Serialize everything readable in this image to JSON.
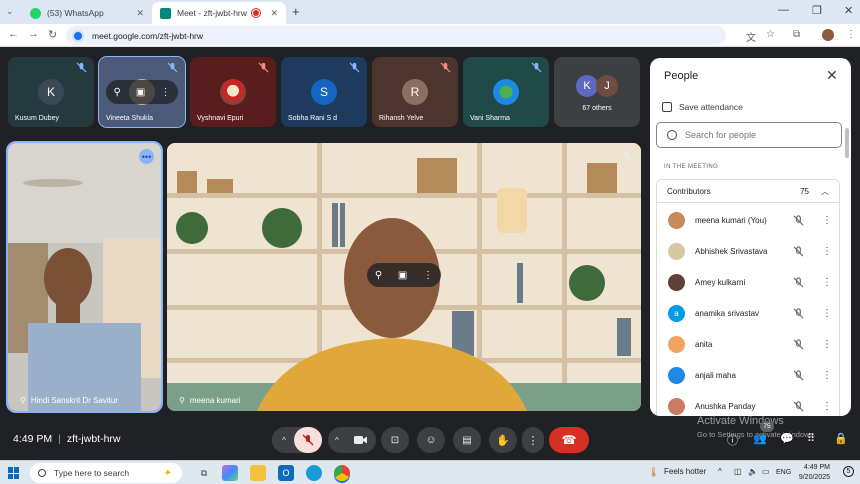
{
  "browser": {
    "tabs": [
      {
        "title": "(53) WhatsApp",
        "active": false,
        "favicon_color": "#25d366"
      },
      {
        "title": "Meet - zft-jwbt-hrw",
        "active": true,
        "favicon_color": "#00897b"
      }
    ],
    "url": "meet.google.com/zft-jwbt-hrw"
  },
  "participants_top": [
    {
      "name": "Kusum Dubey",
      "initial": "K",
      "avatar_color": "#3c4a55",
      "bg": "#253a3e"
    },
    {
      "name": "Vineeta Shukla",
      "bg": "#4a5a78"
    },
    {
      "name": "Vyshnavi Epuri",
      "bg": "#5a1d1d"
    },
    {
      "name": "Sobha Rani S d",
      "initial": "S",
      "avatar_color": "#1565c0",
      "bg": "#1e3b5e"
    },
    {
      "name": "Rihansh Yelve",
      "initial": "R",
      "avatar_color": "#8d6e63",
      "bg": "#4e342e"
    },
    {
      "name": "Vani Sharma",
      "bg": "#1f4a47"
    }
  ],
  "others": {
    "initials": [
      "K",
      "J"
    ],
    "colors": [
      "#5c6bc0",
      "#6d4c41"
    ],
    "label": "67 others"
  },
  "main_tiles": [
    {
      "name": "Hindi Sanskrit Dr Savitur"
    },
    {
      "name": "meena kumari"
    }
  ],
  "panel": {
    "title": "People",
    "save_attendance": "Save attendance",
    "search_placeholder": "Search for people",
    "section_label": "IN THE MEETING",
    "group_label": "Contributors",
    "group_count": "75",
    "people": [
      {
        "name": "meena kumari (You)",
        "color": "#c58b5a",
        "initial": ""
      },
      {
        "name": "Abhishek Srivastava",
        "color": "#d6c7a5",
        "initial": ""
      },
      {
        "name": "Amey kulkarni",
        "color": "#5d4037",
        "initial": ""
      },
      {
        "name": "anamika srivastav",
        "color": "#039be5",
        "initial": "a"
      },
      {
        "name": "anita",
        "color": "#f4a261",
        "initial": ""
      },
      {
        "name": "anjali maha",
        "color": "#1e88e5",
        "initial": ""
      },
      {
        "name": "Anushka Panday",
        "color": "#c97b63",
        "initial": ""
      }
    ]
  },
  "meeting": {
    "time": "4:49 PM",
    "code": "zft-jwbt-hrw",
    "participant_badge": "75"
  },
  "watermark": {
    "line1": "Activate Windows",
    "line2": "Go to Settings to activate Windows."
  },
  "taskbar": {
    "search_placeholder": "Type here to search",
    "weather": "Feels hotter",
    "lang": "ENG",
    "time": "4:49 PM",
    "date": "9/20/2025"
  }
}
